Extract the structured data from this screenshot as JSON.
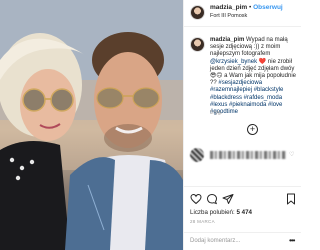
{
  "post": {
    "username": "madzia_pim",
    "separator": "•",
    "follow_label": "Obserwuj",
    "location": "Fort III Pomosk",
    "caption_user": "madzia_pim",
    "caption_text": "Wypad na małą sesje zdjęciową :)) z moim najlepszym fotografem",
    "mention": "@krzysiek_bynek",
    "caption_text_2": "❤️ nie zrobił jeden dzień zdjęć zdjęłam dwóy 😎🙃 a Wam jak mija popołudnie ??",
    "hashtags": "#sesjazdjeciowa #razemnajlepiej #blackstyle #blackdress #rafdes_moda #lexus #pieknaimoda #love #goodtime",
    "time_ago": "5 tyg.",
    "load_more_symbol": "+"
  },
  "blurred_comment": {
    "heart": "♡"
  },
  "actions": {
    "like_icon": "heart-icon",
    "comment_icon": "comment-bubble-icon",
    "share_icon": "paper-plane-icon",
    "save_icon": "bookmark-icon"
  },
  "likes": {
    "label": "Liczba polubień:",
    "count": "5 474"
  },
  "date": "28 MARCA",
  "comment_box": {
    "placeholder": "Dodaj komentarz...",
    "more_symbol": "•••"
  },
  "colors": {
    "accent": "#3897f0",
    "text": "#262626",
    "muted": "#999999",
    "border": "#efefef"
  }
}
